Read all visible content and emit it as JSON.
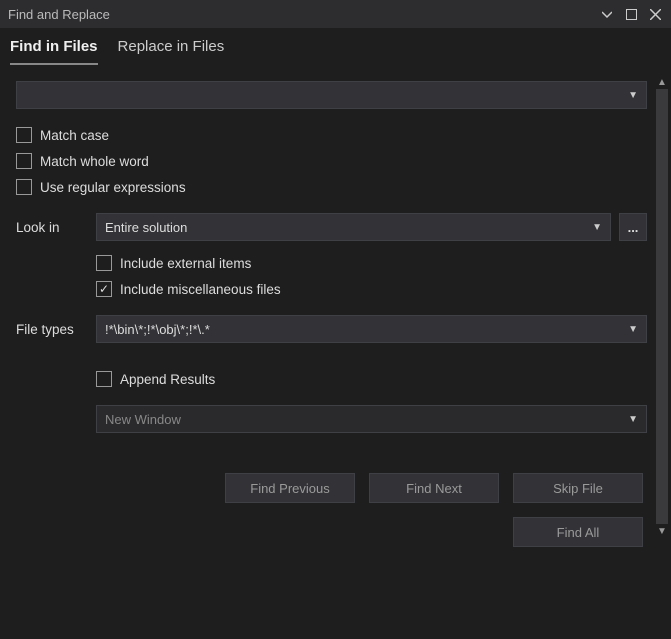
{
  "title": "Find and Replace",
  "tabs": {
    "find": "Find in Files",
    "replace": "Replace in Files"
  },
  "search_value": "",
  "checkboxes": {
    "match_case": "Match case",
    "match_whole_word": "Match whole word",
    "use_regex": "Use regular expressions",
    "include_external": "Include external items",
    "include_misc": "Include miscellaneous files",
    "append_results": "Append Results"
  },
  "labels": {
    "look_in": "Look in",
    "file_types": "File types"
  },
  "look_in_value": "Entire solution",
  "file_types_value": "!*\\bin\\*;!*\\obj\\*;!*\\.*",
  "results_window": "New Window",
  "buttons": {
    "find_previous": "Find Previous",
    "find_next": "Find Next",
    "skip_file": "Skip File",
    "find_all": "Find All",
    "browse": "..."
  }
}
